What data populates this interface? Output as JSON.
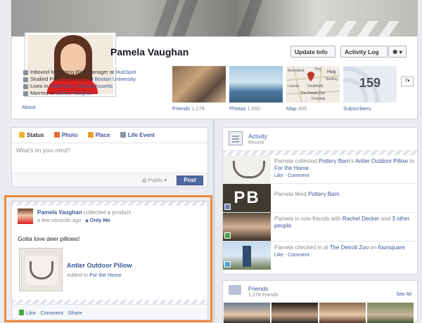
{
  "profile": {
    "name": "Pamela Vaughan",
    "update_info": "Update Info",
    "activity_log": "Activity Log",
    "settings_label": "✱ ▾",
    "info": [
      {
        "icon": "briefcase-icon",
        "prefix": "Inbound Marketing Blog Manager at ",
        "link": "HubSpot"
      },
      {
        "icon": "graduation-cap-icon",
        "prefix": "Studied Public Relations at ",
        "link": "Boston University"
      },
      {
        "icon": "house-icon",
        "prefix": "Lives in ",
        "link": "Watertown, Massachusetts"
      },
      {
        "icon": "heart-icon",
        "prefix": "Married to ",
        "link": "James Vaughan"
      }
    ],
    "about": "About",
    "tiles": {
      "friends": {
        "label": "Friends",
        "count": "1,278"
      },
      "photos": {
        "label": "Photos",
        "count": "1,592"
      },
      "map": {
        "label": "Map",
        "count": "405",
        "places": [
          "Bloomfield",
          "Troy",
          "Heig",
          "Sterling",
          "Southfield",
          "The Detroit Zoo",
          "Ferndale",
          "Livonia"
        ]
      },
      "subscribers": {
        "label": "Subscribers",
        "count": "159"
      }
    },
    "more_label": "7▾"
  },
  "composer": {
    "tabs": [
      {
        "label": "Status",
        "icon": "status-icon"
      },
      {
        "label": "Photo",
        "icon": "photo-icon"
      },
      {
        "label": "Place",
        "icon": "place-icon"
      },
      {
        "label": "Life Event",
        "icon": "life-event-icon"
      }
    ],
    "placeholder": "What's on your mind?",
    "privacy": "Public",
    "post": "Post"
  },
  "story": {
    "author": "Pamela Vaughan",
    "action": "collected a product.",
    "time": "a few seconds ago",
    "audience": "Only Me",
    "text": "Gotta love deer pillows!",
    "product_name": "Antler Outdoor Pillow",
    "added_prefix": "Added to ",
    "added_link": "For the Home",
    "actions": [
      "Like",
      "Comment",
      "Share"
    ]
  },
  "activity": {
    "title": "Activity",
    "subtitle": "Recent",
    "items": [
      {
        "pre": "Pamela collected ",
        "l1": "Pottery Barn",
        "mid": "'s ",
        "l2": "Antler Outdoor Pillow",
        "mid2": " to ",
        "l3": "For the Home",
        "end": ".",
        "links": "Like · Comment"
      },
      {
        "pre": "Pamela liked ",
        "l1": "Pottery Barn",
        "mid": ".",
        "l2": "",
        "mid2": "",
        "l3": "",
        "end": "",
        "links": ""
      },
      {
        "pre": "Pamela is now friends with ",
        "l1": "Rachel Decker",
        "mid": " and ",
        "l2": "3 other people",
        "mid2": ".",
        "l3": "",
        "end": "",
        "links": ""
      },
      {
        "pre": "Pamela checked in at ",
        "l1": "The Detroit Zoo",
        "mid": " on ",
        "l2": "foursquare",
        "mid2": ".",
        "l3": "",
        "end": "",
        "links": "Like · Comment"
      }
    ],
    "pr_logo": "PB"
  },
  "friends": {
    "title": "Friends",
    "count": "1,278 Friends",
    "see_all": "See All"
  }
}
